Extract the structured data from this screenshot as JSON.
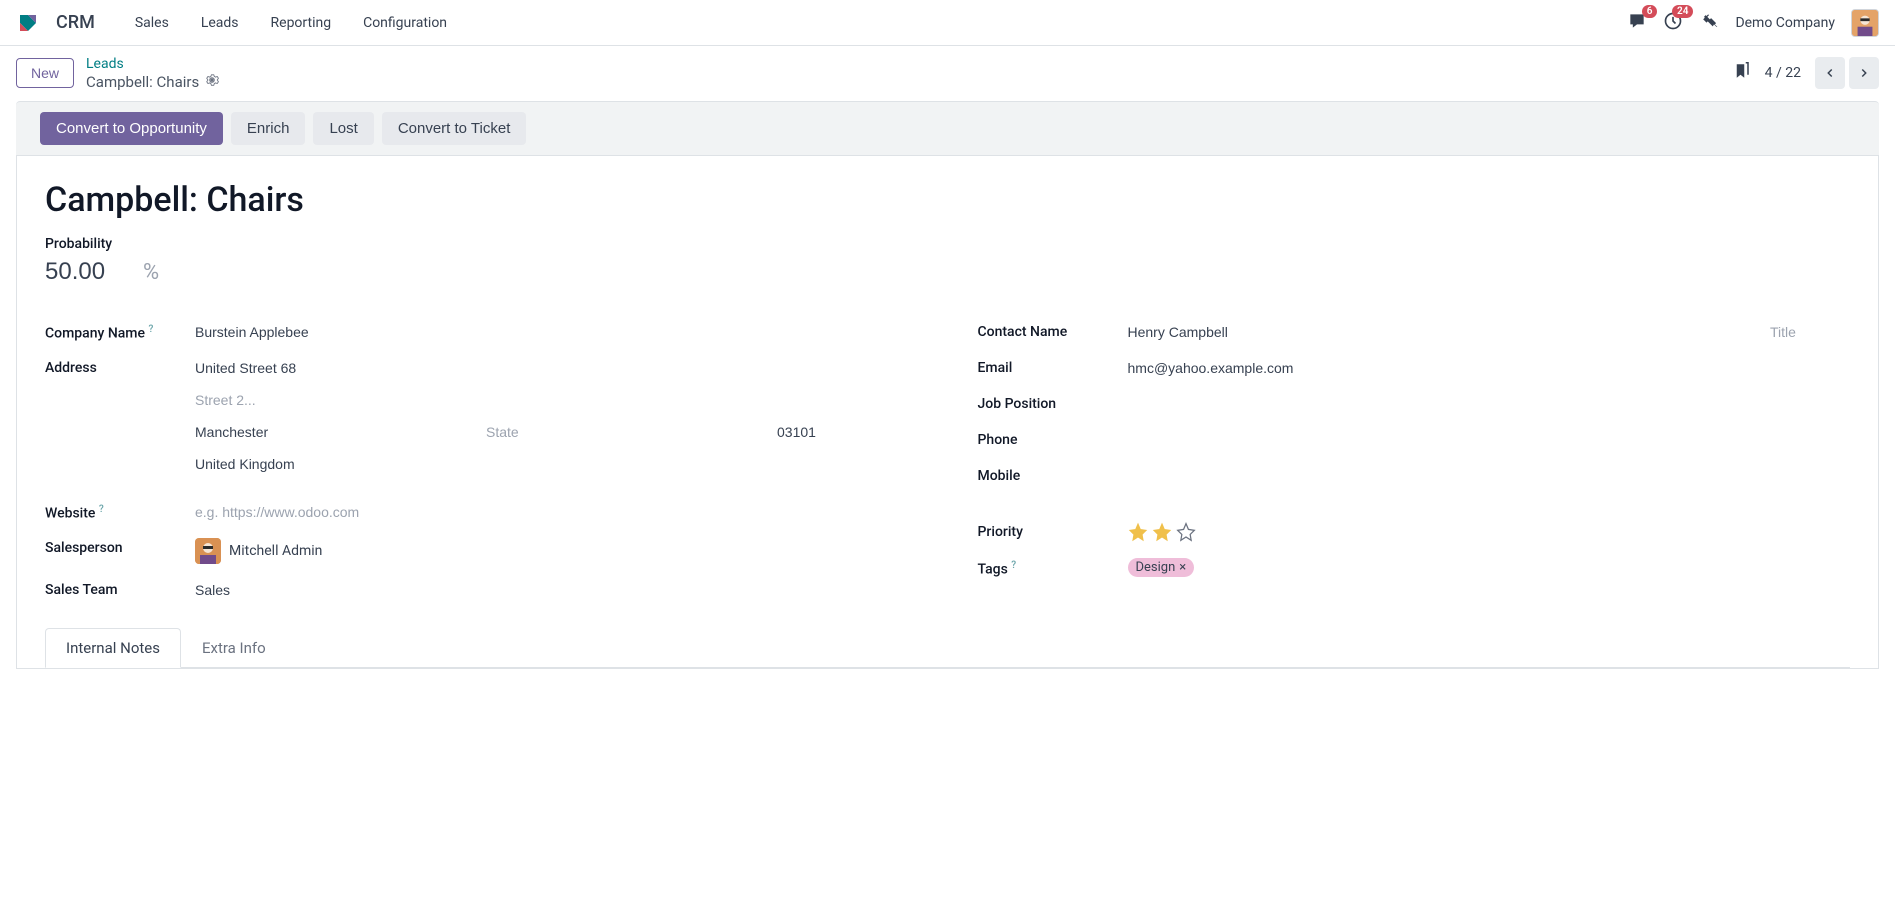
{
  "nav": {
    "app_name": "CRM",
    "items": [
      "Sales",
      "Leads",
      "Reporting",
      "Configuration"
    ],
    "messages_badge": "6",
    "activities_badge": "24",
    "company": "Demo Company"
  },
  "control": {
    "new_label": "New",
    "breadcrumb_parent": "Leads",
    "breadcrumb_current": "Campbell: Chairs",
    "pager": "4 / 22"
  },
  "actions": {
    "convert_opp": "Convert to Opportunity",
    "enrich": "Enrich",
    "lost": "Lost",
    "convert_ticket": "Convert to Ticket"
  },
  "record": {
    "title": "Campbell: Chairs",
    "probability_label": "Probability",
    "probability_value": "50.00",
    "probability_symbol": "%"
  },
  "left_fields": {
    "company_name_label": "Company Name",
    "company_name": "Burstein Applebee",
    "address_label": "Address",
    "street": "United Street 68",
    "street2_placeholder": "Street 2...",
    "city": "Manchester",
    "state_placeholder": "State",
    "zip": "03101",
    "country": "United Kingdom",
    "website_label": "Website",
    "website_placeholder": "e.g. https://www.odoo.com",
    "salesperson_label": "Salesperson",
    "salesperson": "Mitchell Admin",
    "sales_team_label": "Sales Team",
    "sales_team": "Sales"
  },
  "right_fields": {
    "contact_name_label": "Contact Name",
    "contact_name": "Henry Campbell",
    "title_placeholder": "Title",
    "email_label": "Email",
    "email": "hmc@yahoo.example.com",
    "job_position_label": "Job Position",
    "phone_label": "Phone",
    "mobile_label": "Mobile",
    "priority_label": "Priority",
    "priority_stars_filled": 2,
    "priority_stars_total": 3,
    "tags_label": "Tags",
    "tags": [
      {
        "name": "Design"
      }
    ]
  },
  "tabs": {
    "internal_notes": "Internal Notes",
    "extra_info": "Extra Info"
  }
}
